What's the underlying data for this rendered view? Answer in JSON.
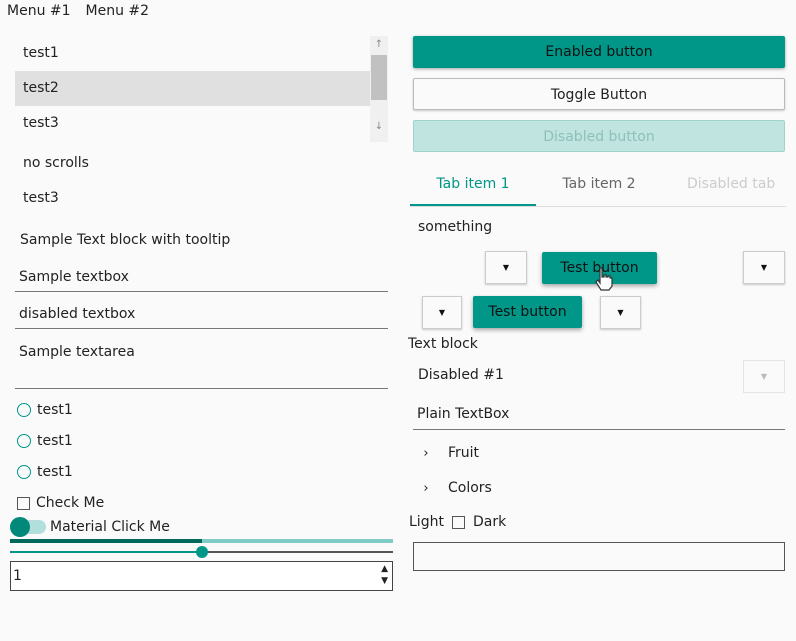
{
  "menu": {
    "items": [
      "Menu #1",
      "Menu #2"
    ]
  },
  "listbox": {
    "items": [
      "test1",
      "test2",
      "test3"
    ],
    "selected": "test2"
  },
  "plain_list": {
    "items": [
      "no scrolls",
      "test3"
    ]
  },
  "tooltip_text": "Sample Text block with tooltip",
  "textbox": {
    "value": "Sample textbox"
  },
  "disabled_textbox": {
    "value": "disabled textbox"
  },
  "textarea": {
    "value": "Sample textarea"
  },
  "radios": [
    "test1",
    "test1",
    "test1"
  ],
  "checkbox": {
    "label": "Check Me",
    "checked": false
  },
  "toggle": {
    "label": "Material Click Me",
    "on": true
  },
  "progress": {
    "fraction": 0.5
  },
  "slider": {
    "fraction": 0.5
  },
  "numeric": {
    "value": "1"
  },
  "buttons": {
    "enabled": "Enabled button",
    "toggle": "Toggle Button",
    "disabled": "Disabled button"
  },
  "tabs": [
    "Tab item 1",
    "Tab item 2",
    "Disabled tab"
  ],
  "tab_content": "something",
  "test_buttons": [
    "Test button",
    "Test button"
  ],
  "text_block": "Text block",
  "disabled_combo": {
    "value": "Disabled #1"
  },
  "plain_textbox": {
    "value": "Plain TextBox"
  },
  "tree": [
    "Fruit",
    "Colors"
  ],
  "theme": {
    "light": "Light",
    "dark": "Dark"
  },
  "colors": {
    "accent": "#009688",
    "accent_dark": "#00695c",
    "accent_light": "#80cbc4"
  }
}
